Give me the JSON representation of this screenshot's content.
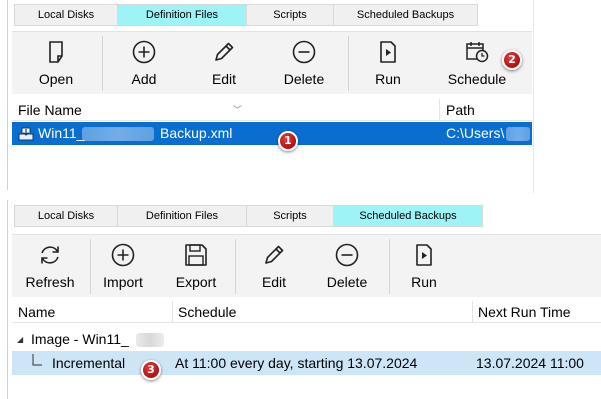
{
  "definition_view": {
    "tabs": [
      {
        "label": "Local Disks",
        "active": false
      },
      {
        "label": "Definition Files",
        "active": true
      },
      {
        "label": "Scripts",
        "active": false
      },
      {
        "label": "Scheduled Backups",
        "active": false
      }
    ],
    "toolbar": {
      "open": {
        "label": "Open",
        "icon": "new-document-icon"
      },
      "add": {
        "label": "Add",
        "icon": "plus-circle-icon"
      },
      "edit": {
        "label": "Edit",
        "icon": "pencil-icon"
      },
      "delete": {
        "label": "Delete",
        "icon": "minus-circle-icon"
      },
      "run": {
        "label": "Run",
        "icon": "run-file-icon"
      },
      "schedule": {
        "label": "Schedule",
        "icon": "calendar-clock-icon"
      }
    },
    "columns": {
      "file_name": "File Name",
      "path": "Path"
    },
    "selected_row": {
      "file_name_prefix": "Win11_",
      "file_name_suffix": "Backup.xml",
      "path": "C:\\Users\\"
    },
    "badges": {
      "row": "1",
      "schedule": "2"
    }
  },
  "scheduled_view": {
    "tabs": [
      {
        "label": "Local Disks",
        "active": false
      },
      {
        "label": "Definition Files",
        "active": false
      },
      {
        "label": "Scripts",
        "active": false
      },
      {
        "label": "Scheduled Backups",
        "active": true
      }
    ],
    "toolbar": {
      "refresh": {
        "label": "Refresh",
        "icon": "refresh-icon"
      },
      "import": {
        "label": "Import",
        "icon": "plus-circle-icon"
      },
      "export": {
        "label": "Export",
        "icon": "save-icon"
      },
      "edit": {
        "label": "Edit",
        "icon": "pencil-icon"
      },
      "delete": {
        "label": "Delete",
        "icon": "minus-circle-icon"
      },
      "run": {
        "label": "Run",
        "icon": "run-file-icon"
      }
    },
    "columns": {
      "name": "Name",
      "schedule": "Schedule",
      "next_run_time": "Next Run Time"
    },
    "group": {
      "label": "Image - Win11_",
      "expander": "◢"
    },
    "row": {
      "name": "Incremental",
      "schedule": "At 11:00 every day, starting 13.07.2024",
      "next_run_time": "13.07.2024 11:00"
    },
    "badges": {
      "row": "3"
    }
  },
  "colors": {
    "selected": "#0a6ed1",
    "active_tab": "#9ef3f7",
    "row_highlight": "#cde6f7",
    "badge": "#c62020"
  }
}
